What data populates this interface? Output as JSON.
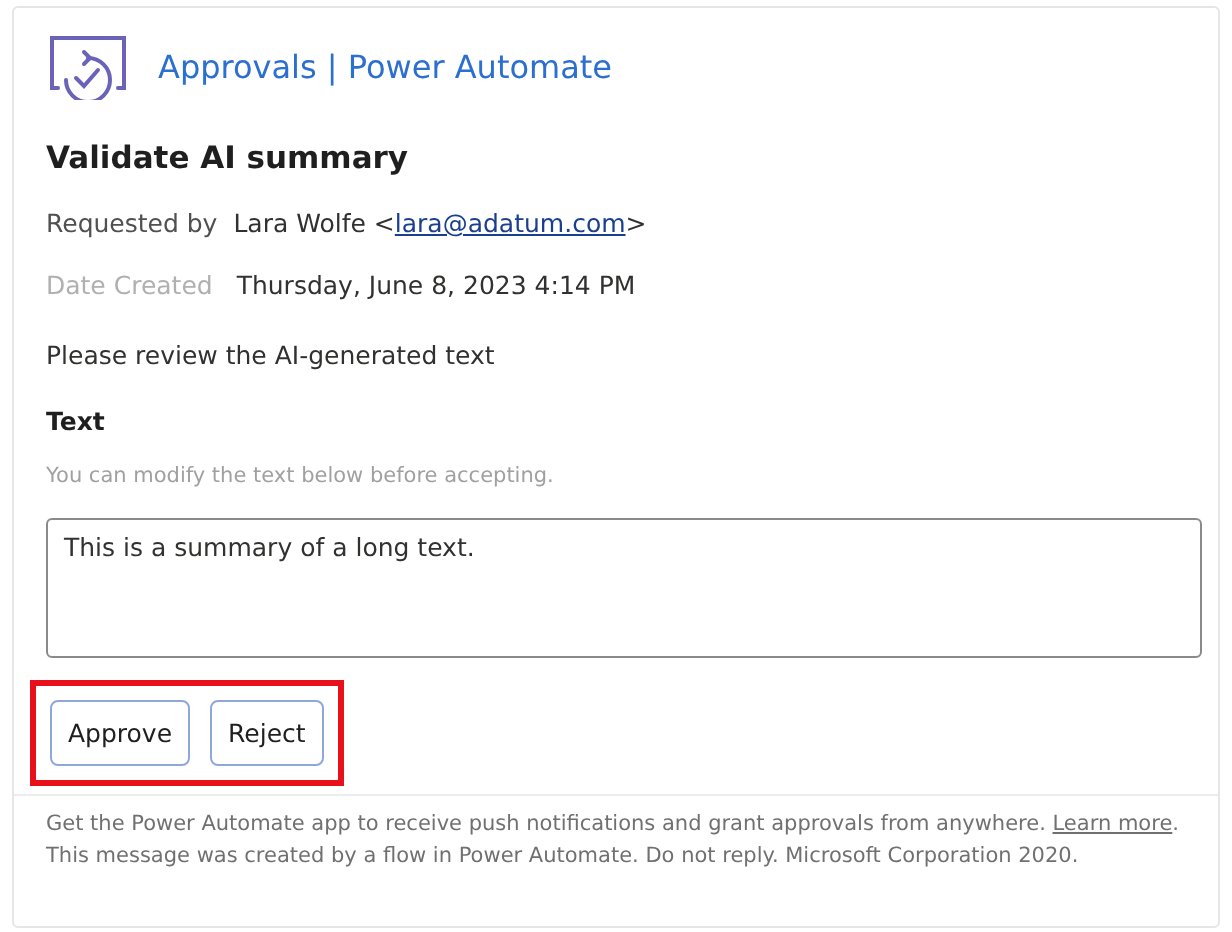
{
  "header": {
    "title": "Approvals | Power Automate"
  },
  "request": {
    "title": "Validate AI summary",
    "requested_by_label": "Requested by",
    "requester_name": "Lara Wolfe <",
    "requester_email": "lara@adatum.com",
    "requester_suffix": ">",
    "date_label": "Date Created",
    "date_value": "Thursday, June 8, 2023 4:14 PM",
    "instructions": "Please review the AI-generated text",
    "field_label": "Text",
    "field_hint": "You can modify the text below before accepting.",
    "field_value": "This is a summary of a long text."
  },
  "buttons": [
    {
      "label": "Approve"
    },
    {
      "label": "Reject"
    }
  ],
  "highlight": true,
  "footer": {
    "before": "Get the Power Automate app to receive push notifications and grant approvals from anywhere. ",
    "link": "Learn more",
    "after": ". This message was created by a flow in Power Automate. Do not reply. Microsoft Corporation 2020."
  }
}
